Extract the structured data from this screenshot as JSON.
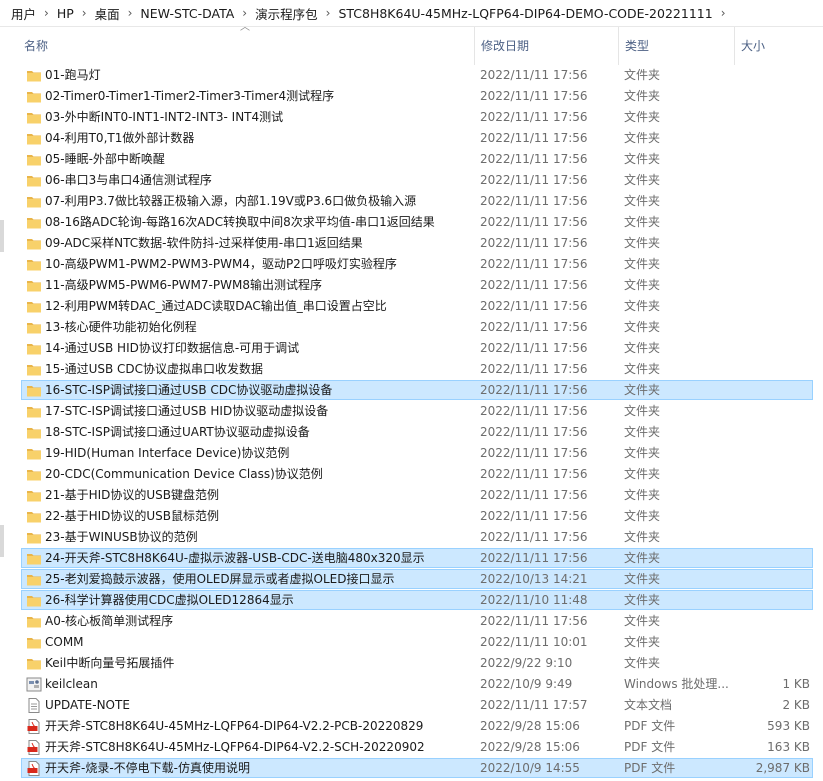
{
  "breadcrumb": [
    "用户",
    "HP",
    "桌面",
    "NEW-STC-DATA",
    "演示程序包",
    "STC8H8K64U-45MHz-LQFP64-DIP64-DEMO-CODE-20221111"
  ],
  "columns": {
    "name": "名称",
    "date": "修改日期",
    "type": "类型",
    "size": "大小"
  },
  "files": [
    {
      "name": "01-跑马灯",
      "date": "2022/11/11 17:56",
      "type": "文件夹",
      "size": "",
      "icon": "folder-icon",
      "selected": false
    },
    {
      "name": "02-Timer0-Timer1-Timer2-Timer3-Timer4测试程序",
      "date": "2022/11/11 17:56",
      "type": "文件夹",
      "size": "",
      "icon": "folder-icon",
      "selected": false
    },
    {
      "name": "03-外中断INT0-INT1-INT2-INT3- INT4测试",
      "date": "2022/11/11 17:56",
      "type": "文件夹",
      "size": "",
      "icon": "folder-icon",
      "selected": false
    },
    {
      "name": "04-利用T0,T1做外部计数器",
      "date": "2022/11/11 17:56",
      "type": "文件夹",
      "size": "",
      "icon": "folder-icon",
      "selected": false
    },
    {
      "name": "05-睡眠-外部中断唤醒",
      "date": "2022/11/11 17:56",
      "type": "文件夹",
      "size": "",
      "icon": "folder-icon",
      "selected": false
    },
    {
      "name": "06-串口3与串口4通信测试程序",
      "date": "2022/11/11 17:56",
      "type": "文件夹",
      "size": "",
      "icon": "folder-icon",
      "selected": false
    },
    {
      "name": "07-利用P3.7做比较器正极输入源，内部1.19V或P3.6口做负极输入源",
      "date": "2022/11/11 17:56",
      "type": "文件夹",
      "size": "",
      "icon": "folder-icon",
      "selected": false
    },
    {
      "name": "08-16路ADC轮询-每路16次ADC转换取中间8次求平均值-串口1返回结果",
      "date": "2022/11/11 17:56",
      "type": "文件夹",
      "size": "",
      "icon": "folder-icon",
      "selected": false
    },
    {
      "name": "09-ADC采样NTC数据-软件防抖-过采样使用-串口1返回结果",
      "date": "2022/11/11 17:56",
      "type": "文件夹",
      "size": "",
      "icon": "folder-icon",
      "selected": false
    },
    {
      "name": "10-高级PWM1-PWM2-PWM3-PWM4，驱动P2口呼吸灯实验程序",
      "date": "2022/11/11 17:56",
      "type": "文件夹",
      "size": "",
      "icon": "folder-icon",
      "selected": false
    },
    {
      "name": "11-高级PWM5-PWM6-PWM7-PWM8输出测试程序",
      "date": "2022/11/11 17:56",
      "type": "文件夹",
      "size": "",
      "icon": "folder-icon",
      "selected": false
    },
    {
      "name": "12-利用PWM转DAC_通过ADC读取DAC输出值_串口设置占空比",
      "date": "2022/11/11 17:56",
      "type": "文件夹",
      "size": "",
      "icon": "folder-icon",
      "selected": false
    },
    {
      "name": "13-核心硬件功能初始化例程",
      "date": "2022/11/11 17:56",
      "type": "文件夹",
      "size": "",
      "icon": "folder-icon",
      "selected": false
    },
    {
      "name": "14-通过USB HID协议打印数据信息-可用于调试",
      "date": "2022/11/11 17:56",
      "type": "文件夹",
      "size": "",
      "icon": "folder-icon",
      "selected": false
    },
    {
      "name": "15-通过USB CDC协议虚拟串口收发数据",
      "date": "2022/11/11 17:56",
      "type": "文件夹",
      "size": "",
      "icon": "folder-icon",
      "selected": false
    },
    {
      "name": "16-STC-ISP调试接口通过USB CDC协议驱动虚拟设备",
      "date": "2022/11/11 17:56",
      "type": "文件夹",
      "size": "",
      "icon": "folder-icon",
      "selected": true
    },
    {
      "name": "17-STC-ISP调试接口通过USB HID协议驱动虚拟设备",
      "date": "2022/11/11 17:56",
      "type": "文件夹",
      "size": "",
      "icon": "folder-icon",
      "selected": false
    },
    {
      "name": "18-STC-ISP调试接口通过UART协议驱动虚拟设备",
      "date": "2022/11/11 17:56",
      "type": "文件夹",
      "size": "",
      "icon": "folder-icon",
      "selected": false
    },
    {
      "name": "19-HID(Human Interface Device)协议范例",
      "date": "2022/11/11 17:56",
      "type": "文件夹",
      "size": "",
      "icon": "folder-icon",
      "selected": false
    },
    {
      "name": "20-CDC(Communication Device Class)协议范例",
      "date": "2022/11/11 17:56",
      "type": "文件夹",
      "size": "",
      "icon": "folder-icon",
      "selected": false
    },
    {
      "name": "21-基于HID协议的USB键盘范例",
      "date": "2022/11/11 17:56",
      "type": "文件夹",
      "size": "",
      "icon": "folder-icon",
      "selected": false
    },
    {
      "name": "22-基于HID协议的USB鼠标范例",
      "date": "2022/11/11 17:56",
      "type": "文件夹",
      "size": "",
      "icon": "folder-icon",
      "selected": false
    },
    {
      "name": "23-基于WINUSB协议的范例",
      "date": "2022/11/11 17:56",
      "type": "文件夹",
      "size": "",
      "icon": "folder-icon",
      "selected": false
    },
    {
      "name": "24-开天斧-STC8H8K64U-虚拟示波器-USB-CDC-送电脑480x320显示",
      "date": "2022/11/11 17:56",
      "type": "文件夹",
      "size": "",
      "icon": "folder-icon",
      "selected": true
    },
    {
      "name": "25-老刘爱捣鼓示波器，使用OLED屏显示或者虚拟OLED接口显示",
      "date": "2022/10/13 14:21",
      "type": "文件夹",
      "size": "",
      "icon": "folder-icon",
      "selected": true
    },
    {
      "name": "26-科学计算器使用CDC虚拟OLED12864显示",
      "date": "2022/11/10 11:48",
      "type": "文件夹",
      "size": "",
      "icon": "folder-icon",
      "selected": true
    },
    {
      "name": "A0-核心板简单测试程序",
      "date": "2022/11/11 17:56",
      "type": "文件夹",
      "size": "",
      "icon": "folder-icon",
      "selected": false
    },
    {
      "name": "COMM",
      "date": "2022/11/11 10:01",
      "type": "文件夹",
      "size": "",
      "icon": "folder-icon",
      "selected": false
    },
    {
      "name": "Keil中断向量号拓展插件",
      "date": "2022/9/22 9:10",
      "type": "文件夹",
      "size": "",
      "icon": "folder-icon",
      "selected": false
    },
    {
      "name": "keilclean",
      "date": "2022/10/9 9:49",
      "type": "Windows 批处理...",
      "size": "1 KB",
      "icon": "batch-file-icon",
      "selected": false
    },
    {
      "name": "UPDATE-NOTE",
      "date": "2022/11/11 17:57",
      "type": "文本文档",
      "size": "2 KB",
      "icon": "text-file-icon",
      "selected": false
    },
    {
      "name": "开天斧-STC8H8K64U-45MHz-LQFP64-DIP64-V2.2-PCB-20220829",
      "date": "2022/9/28 15:06",
      "type": "PDF 文件",
      "size": "593 KB",
      "icon": "pdf-file-icon",
      "selected": false
    },
    {
      "name": "开天斧-STC8H8K64U-45MHz-LQFP64-DIP64-V2.2-SCH-20220902",
      "date": "2022/9/28 15:06",
      "type": "PDF 文件",
      "size": "163 KB",
      "icon": "pdf-file-icon",
      "selected": false
    },
    {
      "name": "开天斧-烧录-不停电下载-仿真使用说明",
      "date": "2022/10/9 14:55",
      "type": "PDF 文件",
      "size": "2,987 KB",
      "icon": "pdf-file-icon",
      "selected": true
    }
  ],
  "colors": {
    "folder": "#f8d16a",
    "folder_tab": "#e9b54a",
    "selection": "#cce8ff",
    "selection_border": "#99d1ff",
    "pdf_red": "#d9291c"
  }
}
